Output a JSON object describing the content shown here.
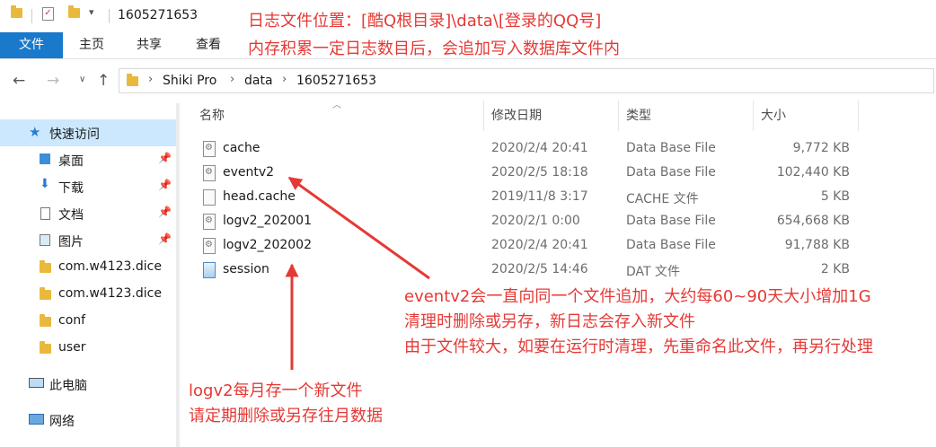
{
  "titlebar": {
    "title": "1605271653"
  },
  "ribbon": {
    "tabs": [
      "文件",
      "主页",
      "共享",
      "查看"
    ]
  },
  "address": {
    "crumbs": [
      "Shiki Pro",
      "data",
      "1605271653"
    ]
  },
  "nav": {
    "quick_access": "快速访问",
    "items": [
      "桌面",
      "下载",
      "文档",
      "图片",
      "com.w4123.dice",
      "com.w4123.dice",
      "conf",
      "user"
    ],
    "this_pc": "此电脑",
    "network": "网络"
  },
  "columns": {
    "name": "名称",
    "modified": "修改日期",
    "type": "类型",
    "size": "大小"
  },
  "files": [
    {
      "name": "cache",
      "modified": "2020/2/4 20:41",
      "type": "Data Base File",
      "size": "9,772 KB"
    },
    {
      "name": "eventv2",
      "modified": "2020/2/5 18:18",
      "type": "Data Base File",
      "size": "102,440 KB"
    },
    {
      "name": "head.cache",
      "modified": "2019/11/8 3:17",
      "type": "CACHE 文件",
      "size": "5 KB"
    },
    {
      "name": "logv2_202001",
      "modified": "2020/2/1 0:00",
      "type": "Data Base File",
      "size": "654,668 KB"
    },
    {
      "name": "logv2_202002",
      "modified": "2020/2/4 20:41",
      "type": "Data Base File",
      "size": "91,788 KB"
    },
    {
      "name": "session",
      "modified": "2020/2/5 14:46",
      "type": "DAT 文件",
      "size": "2 KB"
    }
  ],
  "annotations": {
    "top": [
      "日志文件位置：[酷Q根目录]\\data\\[登录的QQ号]",
      "内存积累一定日志数目后，会追加写入数据库文件内"
    ],
    "eventv2": [
      "eventv2会一直向同一个文件追加，大约每60~90天大小增加1G",
      "清理时删除或另存，新日志会存入新文件",
      "由于文件较大，如要在运行时清理，先重命名此文件，再另行处理"
    ],
    "logv2": [
      "logv2每月存一个新文件",
      "请定期删除或另存往月数据"
    ]
  },
  "colors": {
    "ribbon_active": "#1979ca",
    "annotation": "#e53935",
    "nav_selected": "#cce8ff"
  }
}
